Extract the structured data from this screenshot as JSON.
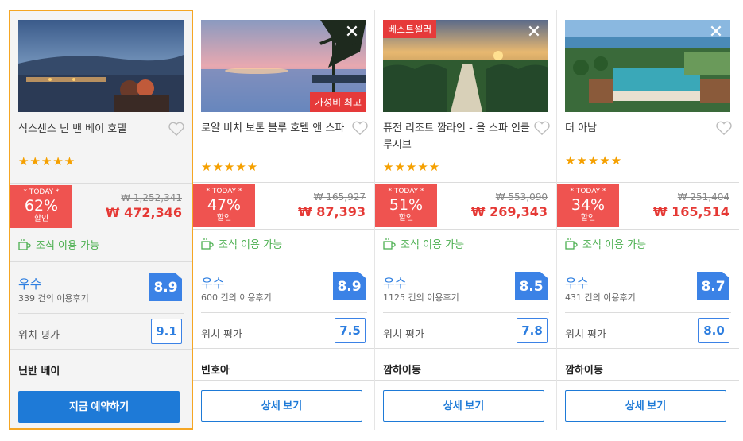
{
  "labels": {
    "today": "* TODAY *",
    "discount": "할인",
    "breakfast": "조식 이용 가능",
    "location": "위치 평가"
  },
  "hotels": [
    {
      "name": "식스센스 닌 밴 베이 호텔",
      "stars": "★★★★★",
      "pct": "62%",
      "old": "₩ 1,252,341",
      "now": "₩ 472,346",
      "grade": "우수",
      "reviews": "339 건의 이용후기",
      "score": "8.9",
      "loc": "9.1",
      "area": "닌반 베이",
      "button": "지금 예약하기",
      "photo": "sunset-deck"
    },
    {
      "name": "로얄 비치 보톤 블루 호텔 앤 스파",
      "stars": "★★★★★",
      "pct": "47%",
      "old": "₩ 165,927",
      "now": "₩ 87,393",
      "grade": "우수",
      "reviews": "600 건의 이용후기",
      "score": "8.9",
      "loc": "7.5",
      "area": "빈호아",
      "button": "상세 보기",
      "badge": "가성비 최고",
      "photo": "infinity-pool"
    },
    {
      "name": "퓨전 리조트 깜라인 - 올 스파 인클루시브",
      "stars": "★★★★★",
      "pct": "51%",
      "old": "₩ 553,090",
      "now": "₩ 269,343",
      "grade": "우수",
      "reviews": "1125 건의 이용후기",
      "score": "8.5",
      "loc": "7.8",
      "area": "깜하이동",
      "button": "상세 보기",
      "badge": "베스트셀러",
      "photo": "palm-sunset"
    },
    {
      "name": "더 아남",
      "stars": "★★★★★",
      "pct": "34%",
      "old": "₩ 251,404",
      "now": "₩ 165,514",
      "grade": "우수",
      "reviews": "431 건의 이용후기",
      "score": "8.7",
      "loc": "8.0",
      "area": "깜하이동",
      "button": "상세 보기",
      "photo": "resort-aerial"
    }
  ],
  "icons": {
    "close": "close-icon",
    "heart": "heart-icon",
    "cup": "coffee-cup-icon"
  },
  "colors": {
    "accent": "#1e7ad7",
    "sale": "#ef5350",
    "selected": "#f5a623",
    "stars": "#f5a000",
    "breakfast": "#4caf50"
  }
}
